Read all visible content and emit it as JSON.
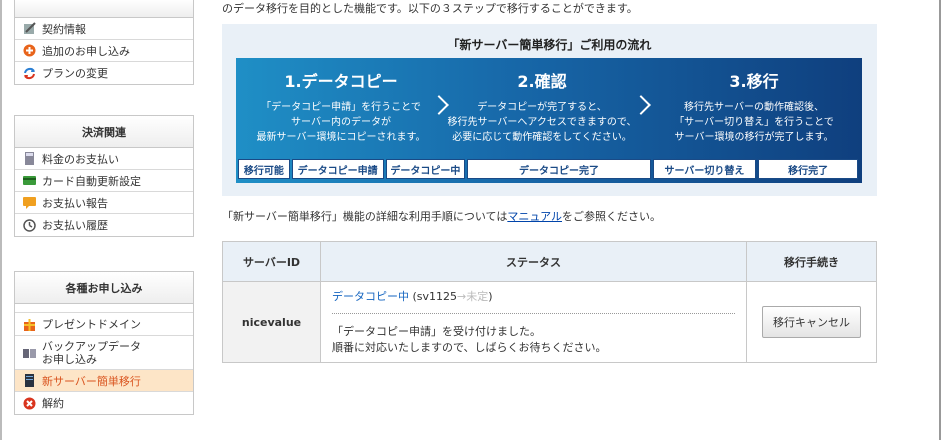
{
  "sidebar": {
    "group1": {
      "items": [
        {
          "label": "契約情報",
          "icon": "document-pen-icon"
        },
        {
          "label": "追加のお申し込み",
          "icon": "plus-circle-icon"
        },
        {
          "label": "プランの変更",
          "icon": "refresh-arrows-icon"
        }
      ]
    },
    "group2": {
      "title": "決済関連",
      "items": [
        {
          "label": "料金のお支払い",
          "icon": "calculator-icon"
        },
        {
          "label": "カード自動更新設定",
          "icon": "credit-card-icon"
        },
        {
          "label": "お支払い報告",
          "icon": "message-icon"
        },
        {
          "label": "お支払い履歴",
          "icon": "clock-icon"
        }
      ]
    },
    "group3": {
      "title": "各種お申し込み",
      "items": [
        {
          "label": "プレゼントドメイン",
          "icon": "gift-icon"
        },
        {
          "label": "バックアップデータ\nお申し込み",
          "icon": "backup-server-icon"
        },
        {
          "label": "新サーバー簡単移行",
          "icon": "server-icon",
          "active": true
        },
        {
          "label": "解約",
          "icon": "cancel-circle-icon"
        }
      ]
    }
  },
  "main": {
    "intro": "のデータ移行を目的とした機能です。以下の３ステップで移行することができます。",
    "flow_title": "「新サーバー簡単移行」ご利用の流れ",
    "steps": [
      {
        "title": "1.データコピー",
        "desc1": "「データコピー申請」を行うことで",
        "desc2": "サーバー内のデータが",
        "desc3": "最新サーバー環境にコピーされます。"
      },
      {
        "title": "2.確認",
        "desc1": "データコピーが完了すると、",
        "desc2": "移行先サーバーへアクセスできますので、",
        "desc3": "必要に応じて動作確認をしてください。"
      },
      {
        "title": "3.移行",
        "desc1": "移行先サーバーの動作確認後、",
        "desc2": "「サーバー切り替え」を行うことで",
        "desc3": "サーバー環境の移行が完了します。"
      }
    ],
    "progress": [
      "移行可能",
      "データコピー申請",
      "データコピー中",
      "データコピー完了",
      "サーバー切り替え",
      "移行完了"
    ],
    "manual_before": "「新サーバー簡単移行」機能の詳細な利用手順については",
    "manual_link": "マニュアル",
    "manual_after": "をご参照ください。",
    "table": {
      "headers": [
        "サーバーID",
        "ステータス",
        "移行手続き"
      ],
      "server_id": "nicevalue",
      "status_link": "データコピー中",
      "status_paren_open": " (sv1125",
      "status_arrow": "→未定",
      "status_paren_close": ")",
      "message1": "「データコピー申請」を受け付けました。",
      "message2": "順番に対応いたしますので、しばらくお待ちください。",
      "action_button": "移行キャンセル"
    }
  },
  "colors": {
    "accent": "#1767a8",
    "active_bg": "#fde5c7",
    "active_text": "#d9531e",
    "panel_bg": "#e9f0f7"
  }
}
